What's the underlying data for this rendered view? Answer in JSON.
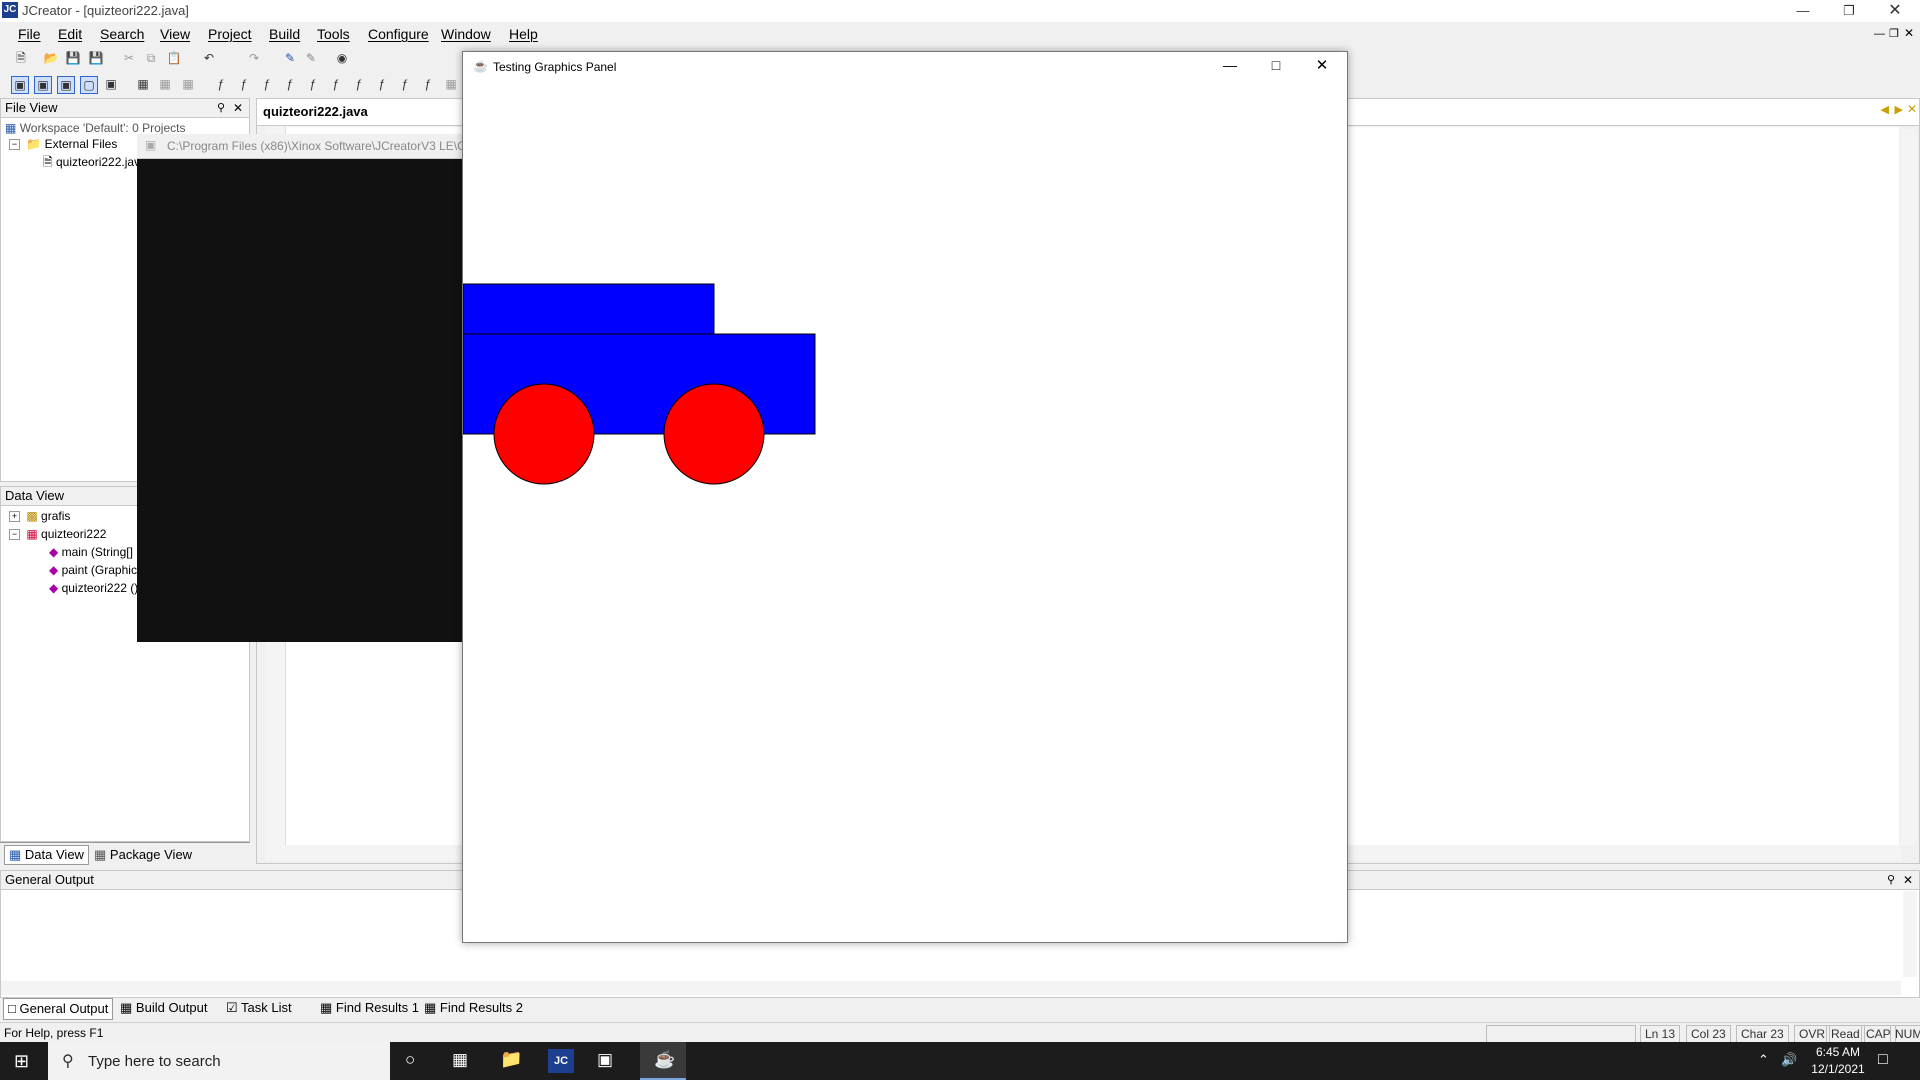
{
  "app": {
    "title": "JCreator - [quizteori222.java]",
    "icon_text": "JC"
  },
  "menu": [
    "File",
    "Edit",
    "Search",
    "View",
    "Project",
    "Build",
    "Tools",
    "Configure",
    "Window",
    "Help"
  ],
  "file_view": {
    "header": "File View",
    "workspace": "Workspace 'Default': 0 Projects",
    "folder": "External Files",
    "file": "quizteori222.java"
  },
  "data_view": {
    "header": "Data View",
    "items": [
      {
        "label": "grafis"
      },
      {
        "label": "quizteori222"
      },
      {
        "label": "main (String[]"
      },
      {
        "label": "paint (Graphic"
      },
      {
        "label": "quizteori222 ()"
      }
    ],
    "tabs": [
      "Data View",
      "Package View"
    ]
  },
  "editor": {
    "tab_label": "quizteori222.java"
  },
  "console": {
    "title": "C:\\Program Files (x86)\\Xinox Software\\JCreatorV3 LE\\GE"
  },
  "graphics_window": {
    "title": "Testing Graphics Panel",
    "colors": {
      "body": "#0000ff",
      "wheel": "#ff0000"
    }
  },
  "output": {
    "header": "General Output",
    "tabs": [
      "General Output",
      "Build Output",
      "Task List",
      "Find Results 1",
      "Find Results 2"
    ]
  },
  "status": {
    "help": "For Help, press F1",
    "ln": "Ln 13",
    "col": "Col 23",
    "char": "Char 23",
    "ovr": "OVR",
    "read": "Read",
    "cap": "CAP",
    "num": "NUM"
  },
  "taskbar": {
    "search_placeholder": "Type here to search",
    "time": "6:45 AM",
    "date": "12/1/2021"
  }
}
